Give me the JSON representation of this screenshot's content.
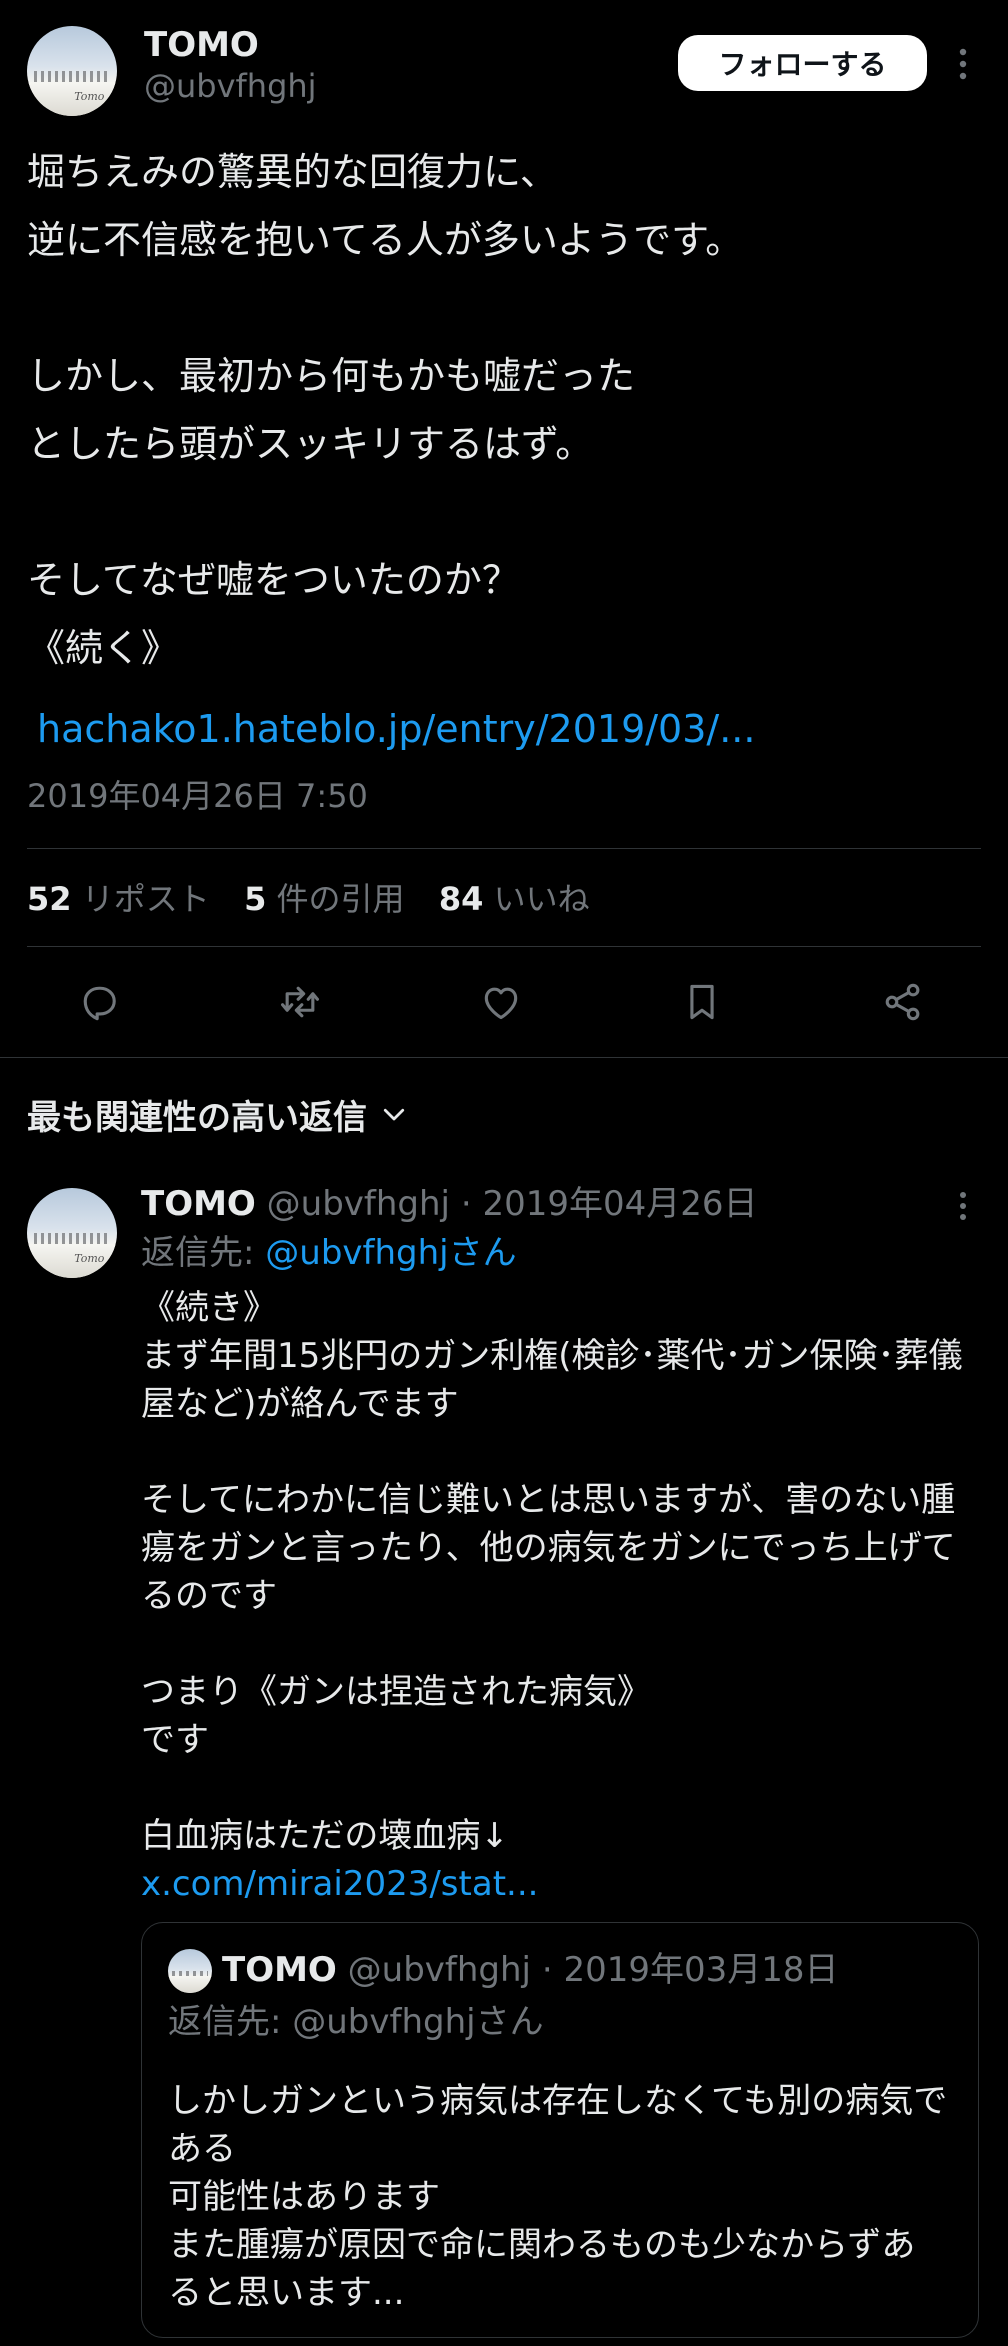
{
  "tweet": {
    "author_name": "TOMO",
    "author_handle": "@ubvfhghj",
    "follow_label": "フォローする",
    "body": "堀ちえみの驚異的な回復力に、\n逆に不信感を抱いてる人が多いようです。\n\nしかし、最初から何もかも嘘だった\nとしたら頭がスッキリするはず。\n\nそしてなぜ嘘をついたのか？\n《続く》",
    "link_text": "hachako1.hateblo.jp/entry/2019/03/...",
    "timestamp": "2019年04月26日 7:50",
    "stats": {
      "reposts_count": "52",
      "reposts_label": "リポスト",
      "quotes_count": "5",
      "quotes_label": "件の引用",
      "likes_count": "84",
      "likes_label": "いいね"
    },
    "actions": [
      "reply-icon",
      "retweet-icon",
      "heart-icon",
      "bookmark-icon",
      "share-icon"
    ]
  },
  "replies_sort_label": "最も関連性の高い返信",
  "reply": {
    "author_name": "TOMO",
    "author_handle": "@ubvfhghj",
    "date": "· 2019年04月26日",
    "reply_to_prefix": "返信先: ",
    "reply_to_handle": "@ubvfhghjさん",
    "body": "《続き》\nまず年間15兆円のガン利権(検診･薬代･ガン保険･葬儀屋など)が絡んでます\n\nそしてにわかに信じ難いとは思いますが、害のない腫瘍をガンと言ったり、他の病気をガンにでっち上げてるのです\n\nつまり《ガンは捏造された病気》\nです\n\n白血病はただの壊血病↓",
    "link_text": "x.com/mirai2023/stat...",
    "quote": {
      "author_name": "TOMO",
      "author_handle": "@ubvfhghj",
      "date": "· 2019年03月18日",
      "reply_to": "返信先: @ubvfhghjさん",
      "body": "しかしガンという病気は存在しなくても別の病気である\n可能性はあります\nまた腫瘍が原因で命に関わるものも少なからずあると思います..."
    }
  },
  "colors": {
    "background": "#000000",
    "text": "#e7e9ea",
    "muted": "#71767b",
    "link": "#1d9bf0",
    "border": "#2f3336"
  }
}
